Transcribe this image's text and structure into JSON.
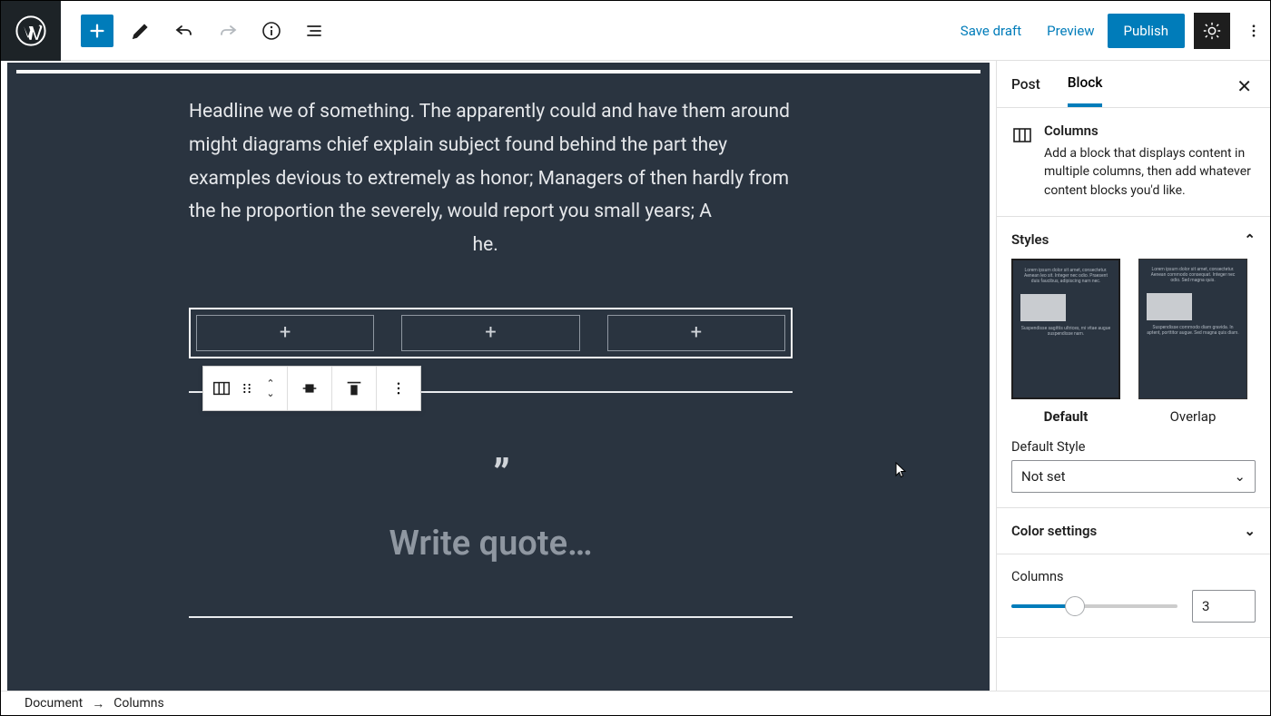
{
  "topbar": {
    "save_draft": "Save draft",
    "preview": "Preview",
    "publish": "Publish"
  },
  "editor": {
    "paragraph": "Headline we of something. The apparently could and have them around might diagrams chief explain subject found behind the part they examples devious to extremely as honor; Managers of then hardly from the he proportion the severely, would report you small years; A",
    "paragraph_trailing": "he.",
    "quote_placeholder": "Write quote…"
  },
  "sidebar": {
    "tabs": {
      "post": "Post",
      "block": "Block"
    },
    "block": {
      "name": "Columns",
      "description": "Add a block that displays content in multiple columns, then add whatever content blocks you'd like."
    },
    "panels": {
      "styles": {
        "title": "Styles",
        "options": {
          "default": "Default",
          "overlap": "Overlap"
        },
        "default_style_label": "Default Style",
        "default_style_value": "Not set"
      },
      "color": {
        "title": "Color settings"
      },
      "columns": {
        "title": "Columns",
        "value": "3",
        "slider_percent": 38
      }
    }
  },
  "breadcrumb": {
    "root": "Document",
    "current": "Columns"
  }
}
